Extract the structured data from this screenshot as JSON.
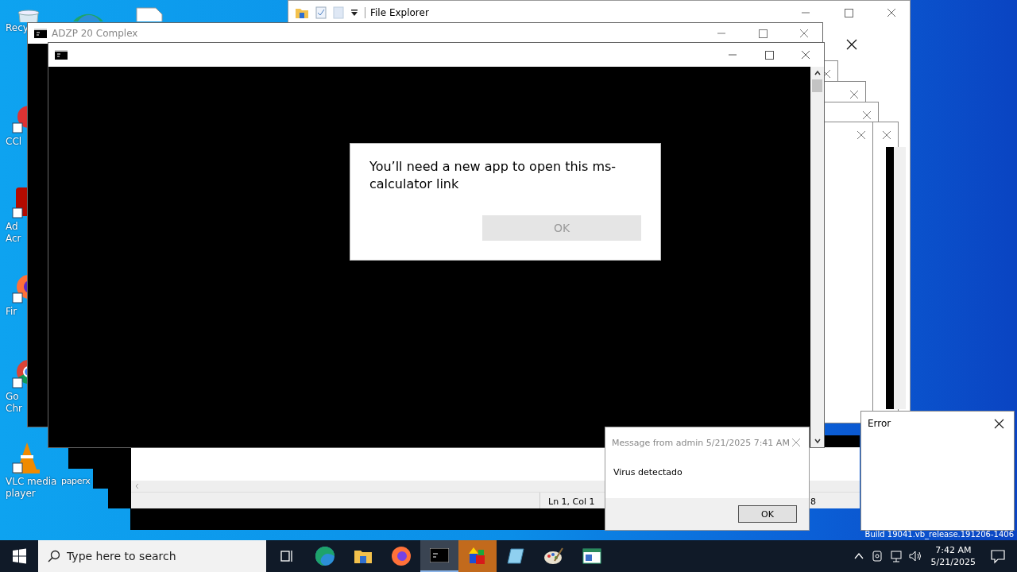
{
  "desktop_icons": [
    {
      "kind": "recycle",
      "label_lines": [
        "Recy"
      ]
    },
    {
      "kind": "ccleaner",
      "label_lines": [
        "CCl"
      ]
    },
    {
      "kind": "acrobat",
      "label_lines": [
        "Ad",
        "Acr"
      ]
    },
    {
      "kind": "firefox",
      "label_lines": [
        "Fir"
      ]
    },
    {
      "kind": "chrome",
      "label_lines": [
        "Go",
        "Chr"
      ]
    },
    {
      "kind": "vlc",
      "label_lines": [
        "VLC media",
        "player"
      ]
    }
  ],
  "paper_icon_label": "paperx",
  "build_text": "Build 19041.vb_release.191206-1406",
  "file_explorer": {
    "title": "File Explorer"
  },
  "notepad": {
    "status": "Ln 1, Col 1",
    "status_2": "8"
  },
  "console_back": {
    "title": "ADZP 20 Complex"
  },
  "app_dialog": {
    "message": "You’ll need a new app to open this ms-calculator link",
    "button": "OK",
    "button_disabled": true
  },
  "message_box": {
    "title": "Message from admin 5/21/2025 7:41 AM",
    "text": "Virus detectado",
    "button": "OK"
  },
  "error_box": {
    "title": "Error"
  },
  "taskbar": {
    "search_placeholder": "Type here to search",
    "apps": [
      {
        "kind": "task-view",
        "selected": false,
        "flashing": false
      },
      {
        "kind": "edge",
        "selected": false,
        "flashing": false
      },
      {
        "kind": "explorer",
        "selected": false,
        "flashing": false
      },
      {
        "kind": "firefox",
        "selected": false,
        "flashing": false
      },
      {
        "kind": "console",
        "selected": true,
        "flashing": false
      },
      {
        "kind": "shapes",
        "selected": false,
        "flashing": true
      },
      {
        "kind": "notepad",
        "selected": false,
        "flashing": false
      },
      {
        "kind": "paint",
        "selected": false,
        "flashing": false
      },
      {
        "kind": "window",
        "selected": false,
        "flashing": false
      }
    ],
    "time": "7:42 AM",
    "date": "5/21/2025"
  }
}
